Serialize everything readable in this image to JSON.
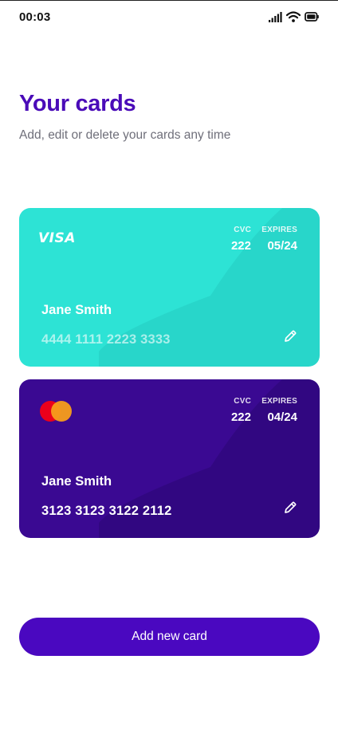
{
  "status_bar": {
    "time": "00:03",
    "icons": [
      "signal-icon",
      "wifi-icon",
      "battery-icon"
    ]
  },
  "header": {
    "title": "Your cards",
    "subtitle": "Add, edit or delete your cards any time"
  },
  "cards": [
    {
      "brand": "VISA",
      "cvc_label": "CVC",
      "cvc": "222",
      "expires_label": "EXPIRES",
      "expires": "05/24",
      "holder": "Jane Smith",
      "number": "4444 1111 2223 3333",
      "color": "#2de3d5"
    },
    {
      "brand_icon": "mastercard-logo",
      "cvc_label": "CVC",
      "cvc": "222",
      "expires_label": "EXPIRES",
      "expires": "04/24",
      "holder": "Jane Smith",
      "number": "3123 3123 3122 2112",
      "color": "#3a0992"
    }
  ],
  "actions": {
    "add_card_label": "Add new card"
  },
  "colors": {
    "accent": "#4a08c0",
    "title": "#4a0bb8"
  }
}
